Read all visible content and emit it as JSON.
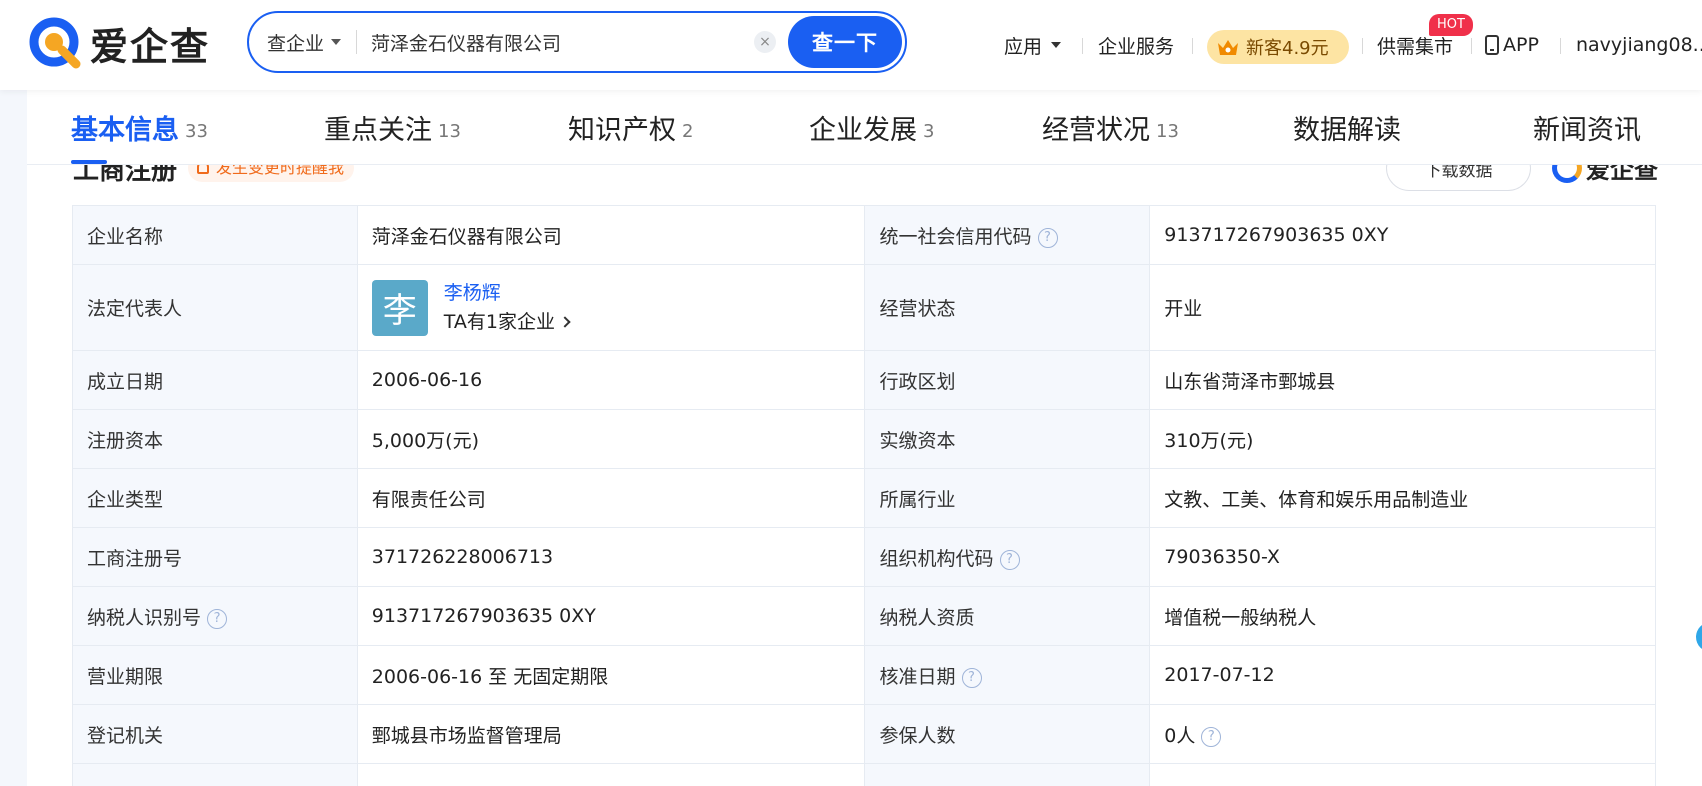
{
  "header": {
    "logo_text": "爱企查",
    "search": {
      "type_label": "查企业",
      "query": "菏泽金石仪器有限公司",
      "clear_label": "×",
      "button_label": "查一下"
    },
    "nav": {
      "apps_label": "应用",
      "enterprise_service_label": "企业服务",
      "vip_label": "新客4.9元",
      "market_label": "供需集市",
      "hot_badge": "HOT",
      "app_label": "APP",
      "username": "navyjiang08..."
    }
  },
  "tabs": [
    {
      "label": "基本信息",
      "count": "33"
    },
    {
      "label": "重点关注",
      "count": "13"
    },
    {
      "label": "知识产权",
      "count": "2"
    },
    {
      "label": "企业发展",
      "count": "3"
    },
    {
      "label": "经营状况",
      "count": "13"
    },
    {
      "label": "数据解读",
      "count": ""
    },
    {
      "label": "新闻资讯",
      "count": ""
    }
  ],
  "section": {
    "title": "工商注册",
    "remind_label": "发生变更时提醒我",
    "download_label": "下载数据",
    "mini_logo_text": "爱企查"
  },
  "table": {
    "rows": [
      {
        "k1": "企业名称",
        "v1": "菏泽金石仪器有限公司",
        "k2": "统一社会信用代码",
        "v2": "913717267903635 0XY"
      },
      {
        "k1": "法定代表人",
        "k2": "经营状态",
        "v2": "开业"
      },
      {
        "k1": "成立日期",
        "v1": "2006-06-16",
        "k2": "行政区划",
        "v2": "山东省菏泽市鄄城县"
      },
      {
        "k1": "注册资本",
        "v1": "5,000万(元)",
        "k2": "实缴资本",
        "v2": "310万(元)"
      },
      {
        "k1": "企业类型",
        "v1": "有限责任公司",
        "k2": "所属行业",
        "v2": "文教、工美、体育和娱乐用品制造业"
      },
      {
        "k1": "工商注册号",
        "v1": "371726228006713",
        "k2": "组织机构代码",
        "v2": "79036350-X"
      },
      {
        "k1": "纳税人识别号",
        "v1": "913717267903635 0XY",
        "k2": "纳税人资质",
        "v2": "增值税一般纳税人"
      },
      {
        "k1": "营业期限",
        "v1": "2006-06-16 至 无固定期限",
        "k2": "核准日期",
        "v2": "2017-07-12"
      },
      {
        "k1": "登记机关",
        "v1": "鄄城县市场监督管理局",
        "k2": "参保人数",
        "v2": "0人"
      }
    ],
    "legal_rep": {
      "avatar_char": "李",
      "name": "李杨辉",
      "sub": "TA有1家企业"
    },
    "help_mark": "?"
  },
  "colors": {
    "brand_blue": "#1a5ff2",
    "hot_red": "#f0304a",
    "vip_gold": "#fde4a3",
    "remind_orange": "#f06a1a"
  }
}
